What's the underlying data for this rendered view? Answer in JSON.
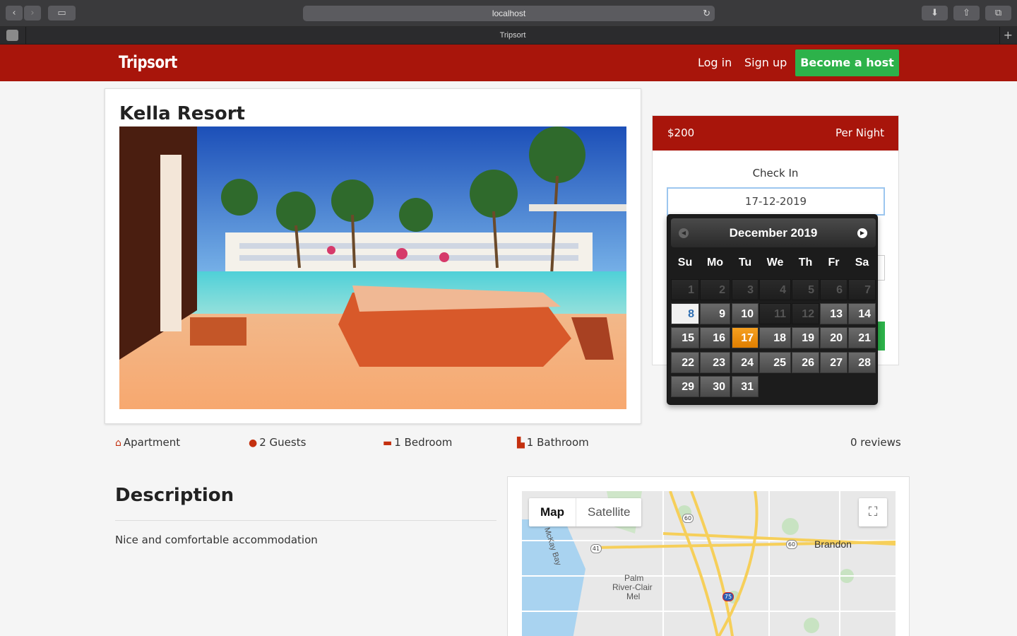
{
  "browser": {
    "url": "localhost",
    "tab_title": "Tripsort"
  },
  "nav": {
    "brand": "Tripsort",
    "login": "Log in",
    "signup": "Sign up",
    "host": "Become a host"
  },
  "listing": {
    "title": "Kella Resort",
    "features": {
      "type": "Apartment",
      "guests": "2 Guests",
      "bedrooms": "1 Bedroom",
      "bathrooms": "1 Bathroom",
      "reviews": "0 reviews"
    },
    "description_heading": "Description",
    "description": "Nice and comfortable accommodation"
  },
  "booking": {
    "price": "$200",
    "per": "Per Night",
    "checkin_label": "Check In",
    "checkin_value": "17-12-2019"
  },
  "datepicker": {
    "title": "December 2019",
    "weekdays": [
      "Su",
      "Mo",
      "Tu",
      "We",
      "Th",
      "Fr",
      "Sa"
    ],
    "days": [
      [
        "1",
        "2",
        "3",
        "4",
        "5",
        "6",
        "7"
      ],
      [
        "8",
        "9",
        "10",
        "11",
        "12",
        "13",
        "14"
      ],
      [
        "15",
        "16",
        "17",
        "18",
        "19",
        "20",
        "21"
      ],
      [
        "22",
        "23",
        "24",
        "25",
        "26",
        "27",
        "28"
      ],
      [
        "29",
        "30",
        "31"
      ]
    ],
    "disabled": [
      "1",
      "2",
      "3",
      "4",
      "5",
      "6",
      "7",
      "11",
      "12"
    ],
    "today": "8",
    "selected": "17"
  },
  "map": {
    "tab_map": "Map",
    "tab_satellite": "Satellite",
    "labels": {
      "brandon": "Brandon",
      "palm1": "Palm",
      "palm2": "River-Clair",
      "palm3": "Mel",
      "mckay": "McKay Bay",
      "r60a": "60",
      "r41": "41",
      "r60b": "60",
      "r75": "75"
    }
  },
  "colors": {
    "brand_red": "#a8150b",
    "host_green": "#2db24a",
    "selected_orange": "#f08c10"
  }
}
